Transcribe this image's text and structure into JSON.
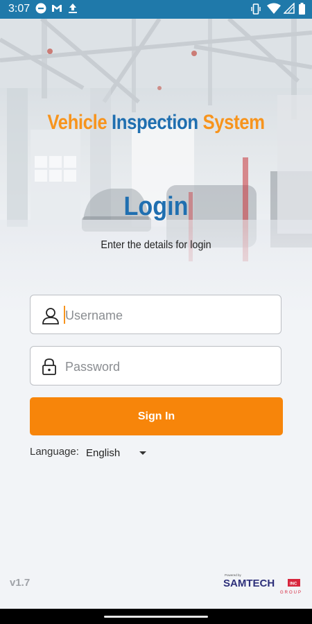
{
  "status_bar": {
    "time": "3:07",
    "left_icons": [
      "do-not-disturb-icon",
      "gmail-icon",
      "upload-icon"
    ],
    "right_icons": [
      "vibrate-icon",
      "wifi-icon",
      "signal-icon",
      "battery-icon"
    ]
  },
  "header": {
    "title_part1": "Vehicle",
    "title_part2": "Inspection",
    "title_part3": "System",
    "heading": "Login",
    "subtitle": "Enter the details for login"
  },
  "form": {
    "username_placeholder": "Username",
    "username_value": "",
    "password_placeholder": "Password",
    "password_value": "",
    "signin_label": "Sign In"
  },
  "language": {
    "label": "Language:",
    "selected": "English"
  },
  "footer": {
    "version": "v1.7",
    "powered_by": "Powered by",
    "brand": "SAMTECH",
    "brand_badge": "INC",
    "group": "GROUP"
  },
  "colors": {
    "accent_orange": "#f7850a",
    "brand_blue": "#1f6fb0",
    "status_bar": "#1f79aa"
  }
}
